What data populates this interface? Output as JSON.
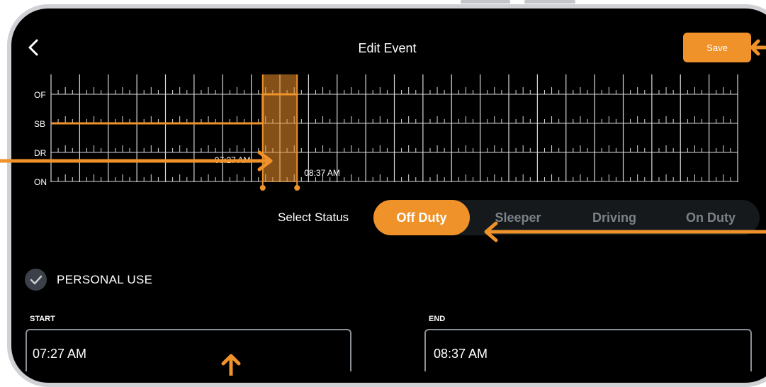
{
  "header": {
    "title": "Edit Event",
    "save_label": "Save"
  },
  "chart_data": {
    "type": "line",
    "ylabels": [
      "OF",
      "SB",
      "DR",
      "ON"
    ],
    "hour_columns": 24,
    "series": [
      {
        "status": "SB",
        "segment": "before selection"
      },
      {
        "status": "OF",
        "segment": "selection"
      }
    ],
    "selection_start_label": "07:27 AM",
    "selection_end_label": "08:37 AM"
  },
  "status": {
    "label": "Select Status",
    "options": [
      "Off Duty",
      "Sleeper",
      "Driving",
      "On Duty"
    ],
    "selected": "Off Duty"
  },
  "personal_use": {
    "label": "PERSONAL USE",
    "checked": true
  },
  "start": {
    "label": "START",
    "value": "07:27 AM"
  },
  "end": {
    "label": "END",
    "value": "08:37 AM"
  },
  "colors": {
    "accent": "#f0922a",
    "background": "#000000",
    "grid": "#d9d9d9"
  },
  "icons": [
    "chevron-left-icon",
    "check-icon",
    "arrow-icon"
  ]
}
